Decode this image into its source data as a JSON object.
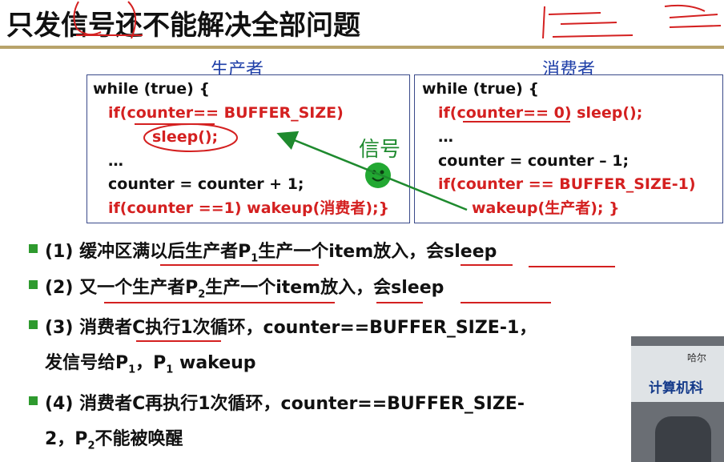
{
  "slide": {
    "title": "只发信号还不能解决全部问题",
    "producer_header": "生产者",
    "consumer_header": "消费者",
    "signal_label": "信号"
  },
  "producer_code": {
    "l1": "while (true) {",
    "l2": "if(counter== BUFFER_SIZE)",
    "l3": "sleep();",
    "l4": "…",
    "l5": "counter = counter + 1;",
    "l6": "if(counter ==1) wakeup(消费者);}"
  },
  "consumer_code": {
    "l1": "while (true) {",
    "l2": "if(counter== 0) sleep();",
    "l3": "…",
    "l4": "counter = counter – 1;",
    "l5": "if(counter == BUFFER_SIZE-1)",
    "l6": "wakeup(生产者); }"
  },
  "bullets": {
    "b1a": "(1) 缓冲区满以后生产者P",
    "b1sub": "1",
    "b1b": "生产一个item放入，会sleep",
    "b2a": "(2) 又一个生产者P",
    "b2sub": "2",
    "b2b": "生产一个item放入，会sleep",
    "b3a": "(3) 消费者C执行1次循环，counter==BUFFER_SIZE-1，",
    "b3b": "发信号给P",
    "b3sub1": "1",
    "b3c": "，P",
    "b3sub2": "1",
    "b3d": " wakeup",
    "b4a": "(4) 消费者C再执行1次循环，counter==BUFFER_SIZE-",
    "b4b": "2，P",
    "b4sub": "2",
    "b4c": "不能被唤醒"
  },
  "video": {
    "line1": "哈尔",
    "line2": "计算机科"
  },
  "colors": {
    "accent_red": "#d42020",
    "header_blue": "#1f3fa8",
    "signal_green": "#1e8a2e"
  }
}
